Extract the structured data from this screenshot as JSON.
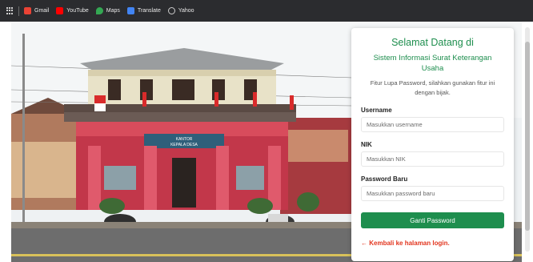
{
  "bookmarks": [
    {
      "label": "Gmail",
      "icon": "gmail-icon",
      "color": "#ea4335"
    },
    {
      "label": "YouTube",
      "icon": "youtube-icon",
      "color": "#ff0000"
    },
    {
      "label": "Maps",
      "icon": "maps-icon",
      "color": "#34a853"
    },
    {
      "label": "Translate",
      "icon": "translate-icon",
      "color": "#4285f4"
    },
    {
      "label": "Yahoo",
      "icon": "yahoo-icon",
      "color": "#cccccc"
    }
  ],
  "building_sign": {
    "line1": "KANTOR",
    "line2": "KEPALA DESA"
  },
  "card": {
    "title": "Selamat Datang di",
    "subtitle": "Sistem Informasi Surat Keterangan Usaha",
    "description": "Fitur Lupa Password, silahkan gunakan fitur ini dengan bijak.",
    "username": {
      "label": "Username",
      "placeholder": "Masukkan username"
    },
    "nik": {
      "label": "NIK",
      "placeholder": "Masukkan NIK"
    },
    "password": {
      "label": "Password Baru",
      "placeholder": "Masukkan password baru"
    },
    "submit_label": "Ganti Password",
    "back_link": "← Kembali ke halaman login."
  },
  "colors": {
    "accent": "#1e8e4e",
    "link": "#e2341d",
    "building": "#c2374a"
  }
}
